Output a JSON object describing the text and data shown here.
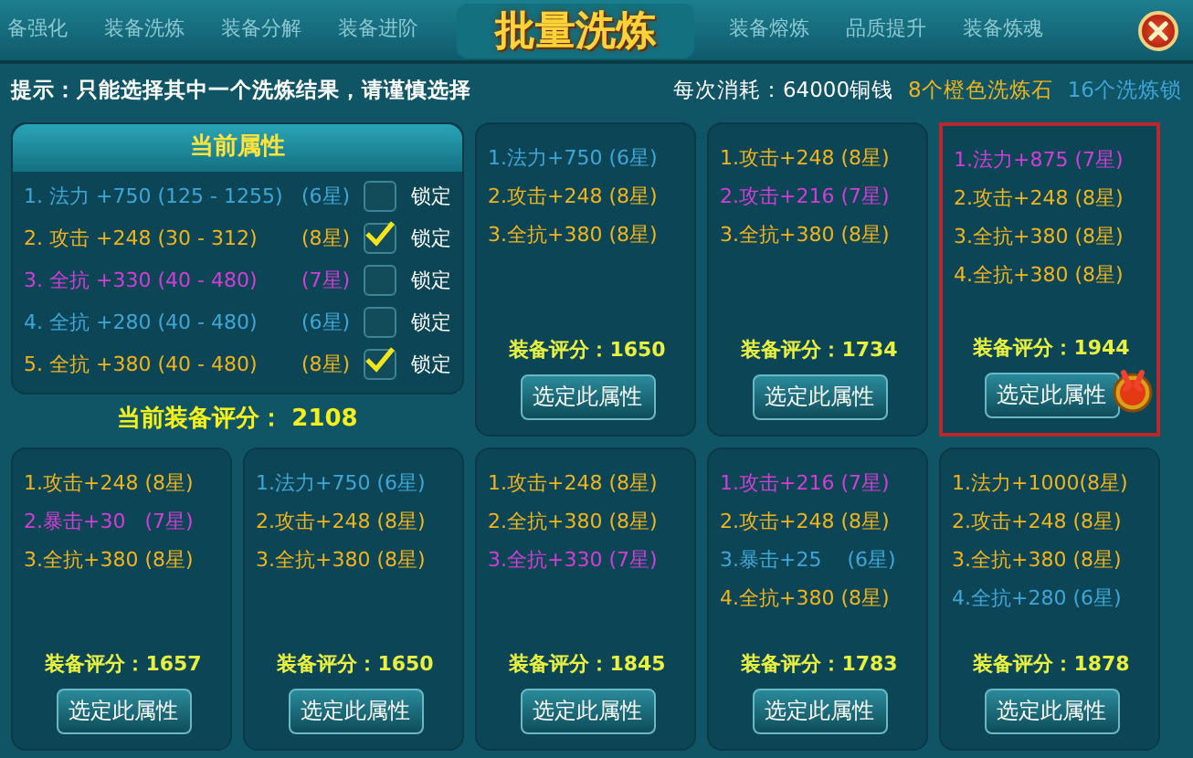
{
  "window": {
    "title": "批量洗炼"
  },
  "background_tabs": [
    "备强化",
    "装备洗炼",
    "装备分解",
    "装备进阶",
    "装备熔炼",
    "品质提升",
    "装备炼魂"
  ],
  "hint": "提示：只能选择其中一个洗炼结果，请谨慎选择",
  "cost": {
    "label": "每次消耗：64000铜钱",
    "stones": "8个橙色洗炼石",
    "locks": "16个洗炼锁"
  },
  "current": {
    "title": "当前属性",
    "score": "当前装备评分： 2108",
    "attributes": [
      {
        "text": "1. 法力 +750 (125 - 1255)",
        "stars": "(6星)",
        "color": "#3fa6d8",
        "checked": false,
        "lock_label": "锁定"
      },
      {
        "text": "2. 攻击 +248 (30 - 312)",
        "stars": "(8星)",
        "color": "#f2b41c",
        "checked": true,
        "lock_label": "锁定"
      },
      {
        "text": "3. 全抗 +330 (40 - 480)",
        "stars": "(7星)",
        "color": "#d23ed6",
        "checked": false,
        "lock_label": "锁定"
      },
      {
        "text": "4. 全抗 +280 (40 - 480)",
        "stars": "(6星)",
        "color": "#3fa6d8",
        "checked": false,
        "lock_label": "锁定"
      },
      {
        "text": "5. 全抗 +380 (40 - 480)",
        "stars": "(8星)",
        "color": "#f2b41c",
        "checked": true,
        "lock_label": "锁定"
      }
    ]
  },
  "results": [
    {
      "selected": false,
      "score": "装备评分：1650",
      "button": "选定此属性",
      "lines": [
        {
          "text": "1.法力+750 (6星)",
          "color": "#3fa6d8"
        },
        {
          "text": "2.攻击+248 (8星)",
          "color": "#f2b41c"
        },
        {
          "text": "3.全抗+380 (8星)",
          "color": "#f2b41c"
        }
      ]
    },
    {
      "selected": false,
      "score": "装备评分：1734",
      "button": "选定此属性",
      "lines": [
        {
          "text": "1.攻击+248 (8星)",
          "color": "#f2b41c"
        },
        {
          "text": "2.攻击+216 (7星)",
          "color": "#d23ed6"
        },
        {
          "text": "3.全抗+380 (8星)",
          "color": "#f2b41c"
        }
      ]
    },
    {
      "selected": true,
      "score": "装备评分：1944",
      "button": "选定此属性",
      "lines": [
        {
          "text": "1.法力+875 (7星)",
          "color": "#d23ed6"
        },
        {
          "text": "2.攻击+248 (8星)",
          "color": "#f2b41c"
        },
        {
          "text": "3.全抗+380 (8星)",
          "color": "#f2b41c"
        },
        {
          "text": "4.全抗+380 (8星)",
          "color": "#f2b41c"
        }
      ]
    },
    {
      "selected": false,
      "score": "装备评分：1657",
      "button": "选定此属性",
      "lines": [
        {
          "text": "1.攻击+248 (8星)",
          "color": "#f2b41c"
        },
        {
          "text": "2.暴击+30   (7星)",
          "color": "#d23ed6"
        },
        {
          "text": "3.全抗+380 (8星)",
          "color": "#f2b41c"
        }
      ]
    },
    {
      "selected": false,
      "score": "装备评分：1650",
      "button": "选定此属性",
      "lines": [
        {
          "text": "1.法力+750 (6星)",
          "color": "#3fa6d8"
        },
        {
          "text": "2.攻击+248 (8星)",
          "color": "#f2b41c"
        },
        {
          "text": "3.全抗+380 (8星)",
          "color": "#f2b41c"
        }
      ]
    },
    {
      "selected": false,
      "score": "装备评分：1845",
      "button": "选定此属性",
      "lines": [
        {
          "text": "1.攻击+248 (8星)",
          "color": "#f2b41c"
        },
        {
          "text": "2.全抗+380 (8星)",
          "color": "#f2b41c"
        },
        {
          "text": "3.全抗+330 (7星)",
          "color": "#d23ed6"
        }
      ]
    },
    {
      "selected": false,
      "score": "装备评分：1783",
      "button": "选定此属性",
      "lines": [
        {
          "text": "1.攻击+216 (7星)",
          "color": "#d23ed6"
        },
        {
          "text": "2.攻击+248 (8星)",
          "color": "#f2b41c"
        },
        {
          "text": "3.暴击+25    (6星)",
          "color": "#3fa6d8"
        },
        {
          "text": "4.全抗+380 (8星)",
          "color": "#f2b41c"
        }
      ]
    },
    {
      "selected": false,
      "score": "装备评分：1878",
      "button": "选定此属性",
      "lines": [
        {
          "text": "1.法力+1000(8星)",
          "color": "#f2b41c"
        },
        {
          "text": "2.攻击+248 (8星)",
          "color": "#f2b41c"
        },
        {
          "text": "3.全抗+380 (8星)",
          "color": "#f2b41c"
        },
        {
          "text": "4.全抗+280 (6星)",
          "color": "#3fa6d8"
        }
      ]
    }
  ]
}
